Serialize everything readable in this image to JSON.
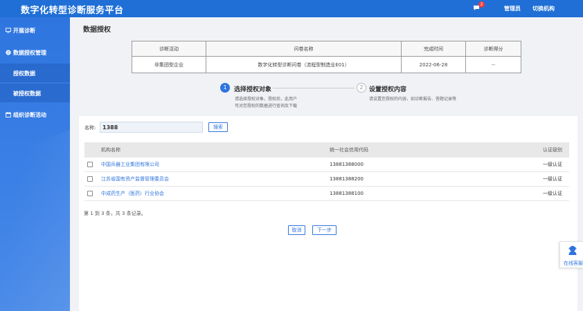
{
  "header": {
    "title": "数字化转型诊断服务平台",
    "message_count": "2",
    "user": "管理员",
    "switch_org": "切换机构"
  },
  "sidebar": {
    "items": [
      {
        "label": "开展诊断",
        "icon": "monitor-icon"
      },
      {
        "label": "数据授权管理",
        "icon": "data-icon"
      },
      {
        "label": "授权数据"
      },
      {
        "label": "被授权数据"
      },
      {
        "label": "组织诊断活动",
        "icon": "calendar-icon"
      }
    ]
  },
  "page": {
    "title": "数据授权"
  },
  "info_table": {
    "headers": [
      "诊断活动",
      "问卷名称",
      "完成时间",
      "诊断得分"
    ],
    "row": [
      "非集团型企业",
      "数字化转型诊断问卷（流程型制造业E01）",
      "2022-06-28",
      "--"
    ]
  },
  "steps": [
    {
      "number": "1",
      "title": "选择授权对象",
      "desc_line1": "请选择授权对象，授权后，此用户",
      "desc_line2": "可对您授权的数据进行查询及下载"
    },
    {
      "number": "2",
      "title": "设置授权内容",
      "desc_line1": "请设置您授权的内容，如诊断报告、答题记录等",
      "desc_line2": ""
    }
  ],
  "search": {
    "label": "名称:",
    "value": "1388",
    "button": "搜索"
  },
  "org_table": {
    "headers": [
      "机构名称",
      "统一社会信用代码",
      "认证级别"
    ],
    "rows": [
      {
        "name": "中国兵器工业集团有限公司",
        "code": "13881388000",
        "level": "一级认证"
      },
      {
        "name": "江苏省国有资产监督管理委员会",
        "code": "13881388200",
        "level": "一级认证"
      },
      {
        "name": "中成药生产（医药）行业协会",
        "code": "13881388100",
        "level": "一级认证"
      }
    ]
  },
  "pagination": {
    "summary": "第 1 到 3 条，共 3 条记录。"
  },
  "actions": {
    "cancel": "取消",
    "next": "下一步"
  },
  "service": {
    "label": "在线客服"
  },
  "colors": {
    "primary": "#1f6fd6",
    "link": "#2f74de",
    "badge": "#f23c3c"
  }
}
